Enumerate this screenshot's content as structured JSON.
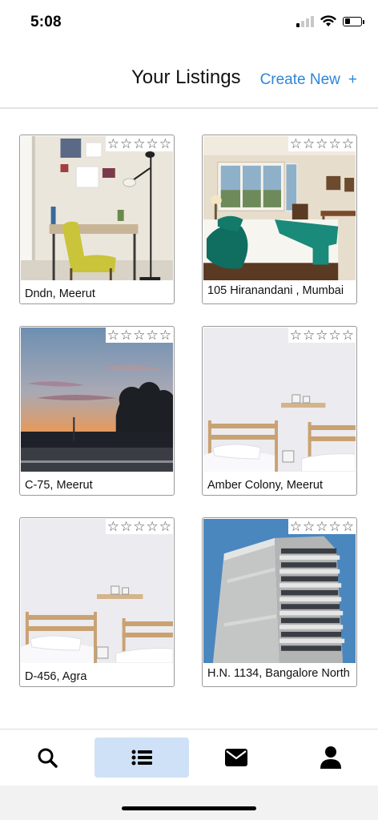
{
  "status_bar": {
    "time": "5:08",
    "battery_level": 0.35,
    "signal_bars_active": 1,
    "signal_bars_total": 4
  },
  "header": {
    "title": "Your Listings",
    "create_new_label": "Create New",
    "create_new_icon": "+"
  },
  "listings": [
    {
      "caption": "Dndn, Meerut",
      "photo": "room-with-yellow-chair-and-desk",
      "stars_filled": 0
    },
    {
      "caption": "105 Hiranandani , Mumbai",
      "photo": "bedroom-with-teal-pillows",
      "stars_filled": 0
    },
    {
      "caption": "C-75, Meerut",
      "photo": "sunset-road-with-trees",
      "stars_filled": 0
    },
    {
      "caption": "Amber Colony, Meerut",
      "photo": "twin-beds-with-shelf",
      "stars_filled": 0
    },
    {
      "caption": "D-456, Agra",
      "photo": "twin-beds-with-shelf",
      "stars_filled": 0
    },
    {
      "caption": "H.N. 1134, Bangalore North",
      "photo": "apartment-tower-blue-sky",
      "stars_filled": 0
    }
  ],
  "rating": {
    "empty_star": "☆",
    "max": 5
  },
  "bottom_nav": [
    {
      "icon": "search-icon",
      "active": false
    },
    {
      "icon": "list-icon",
      "active": true
    },
    {
      "icon": "mail-icon",
      "active": false
    },
    {
      "icon": "person-icon",
      "active": false
    }
  ]
}
